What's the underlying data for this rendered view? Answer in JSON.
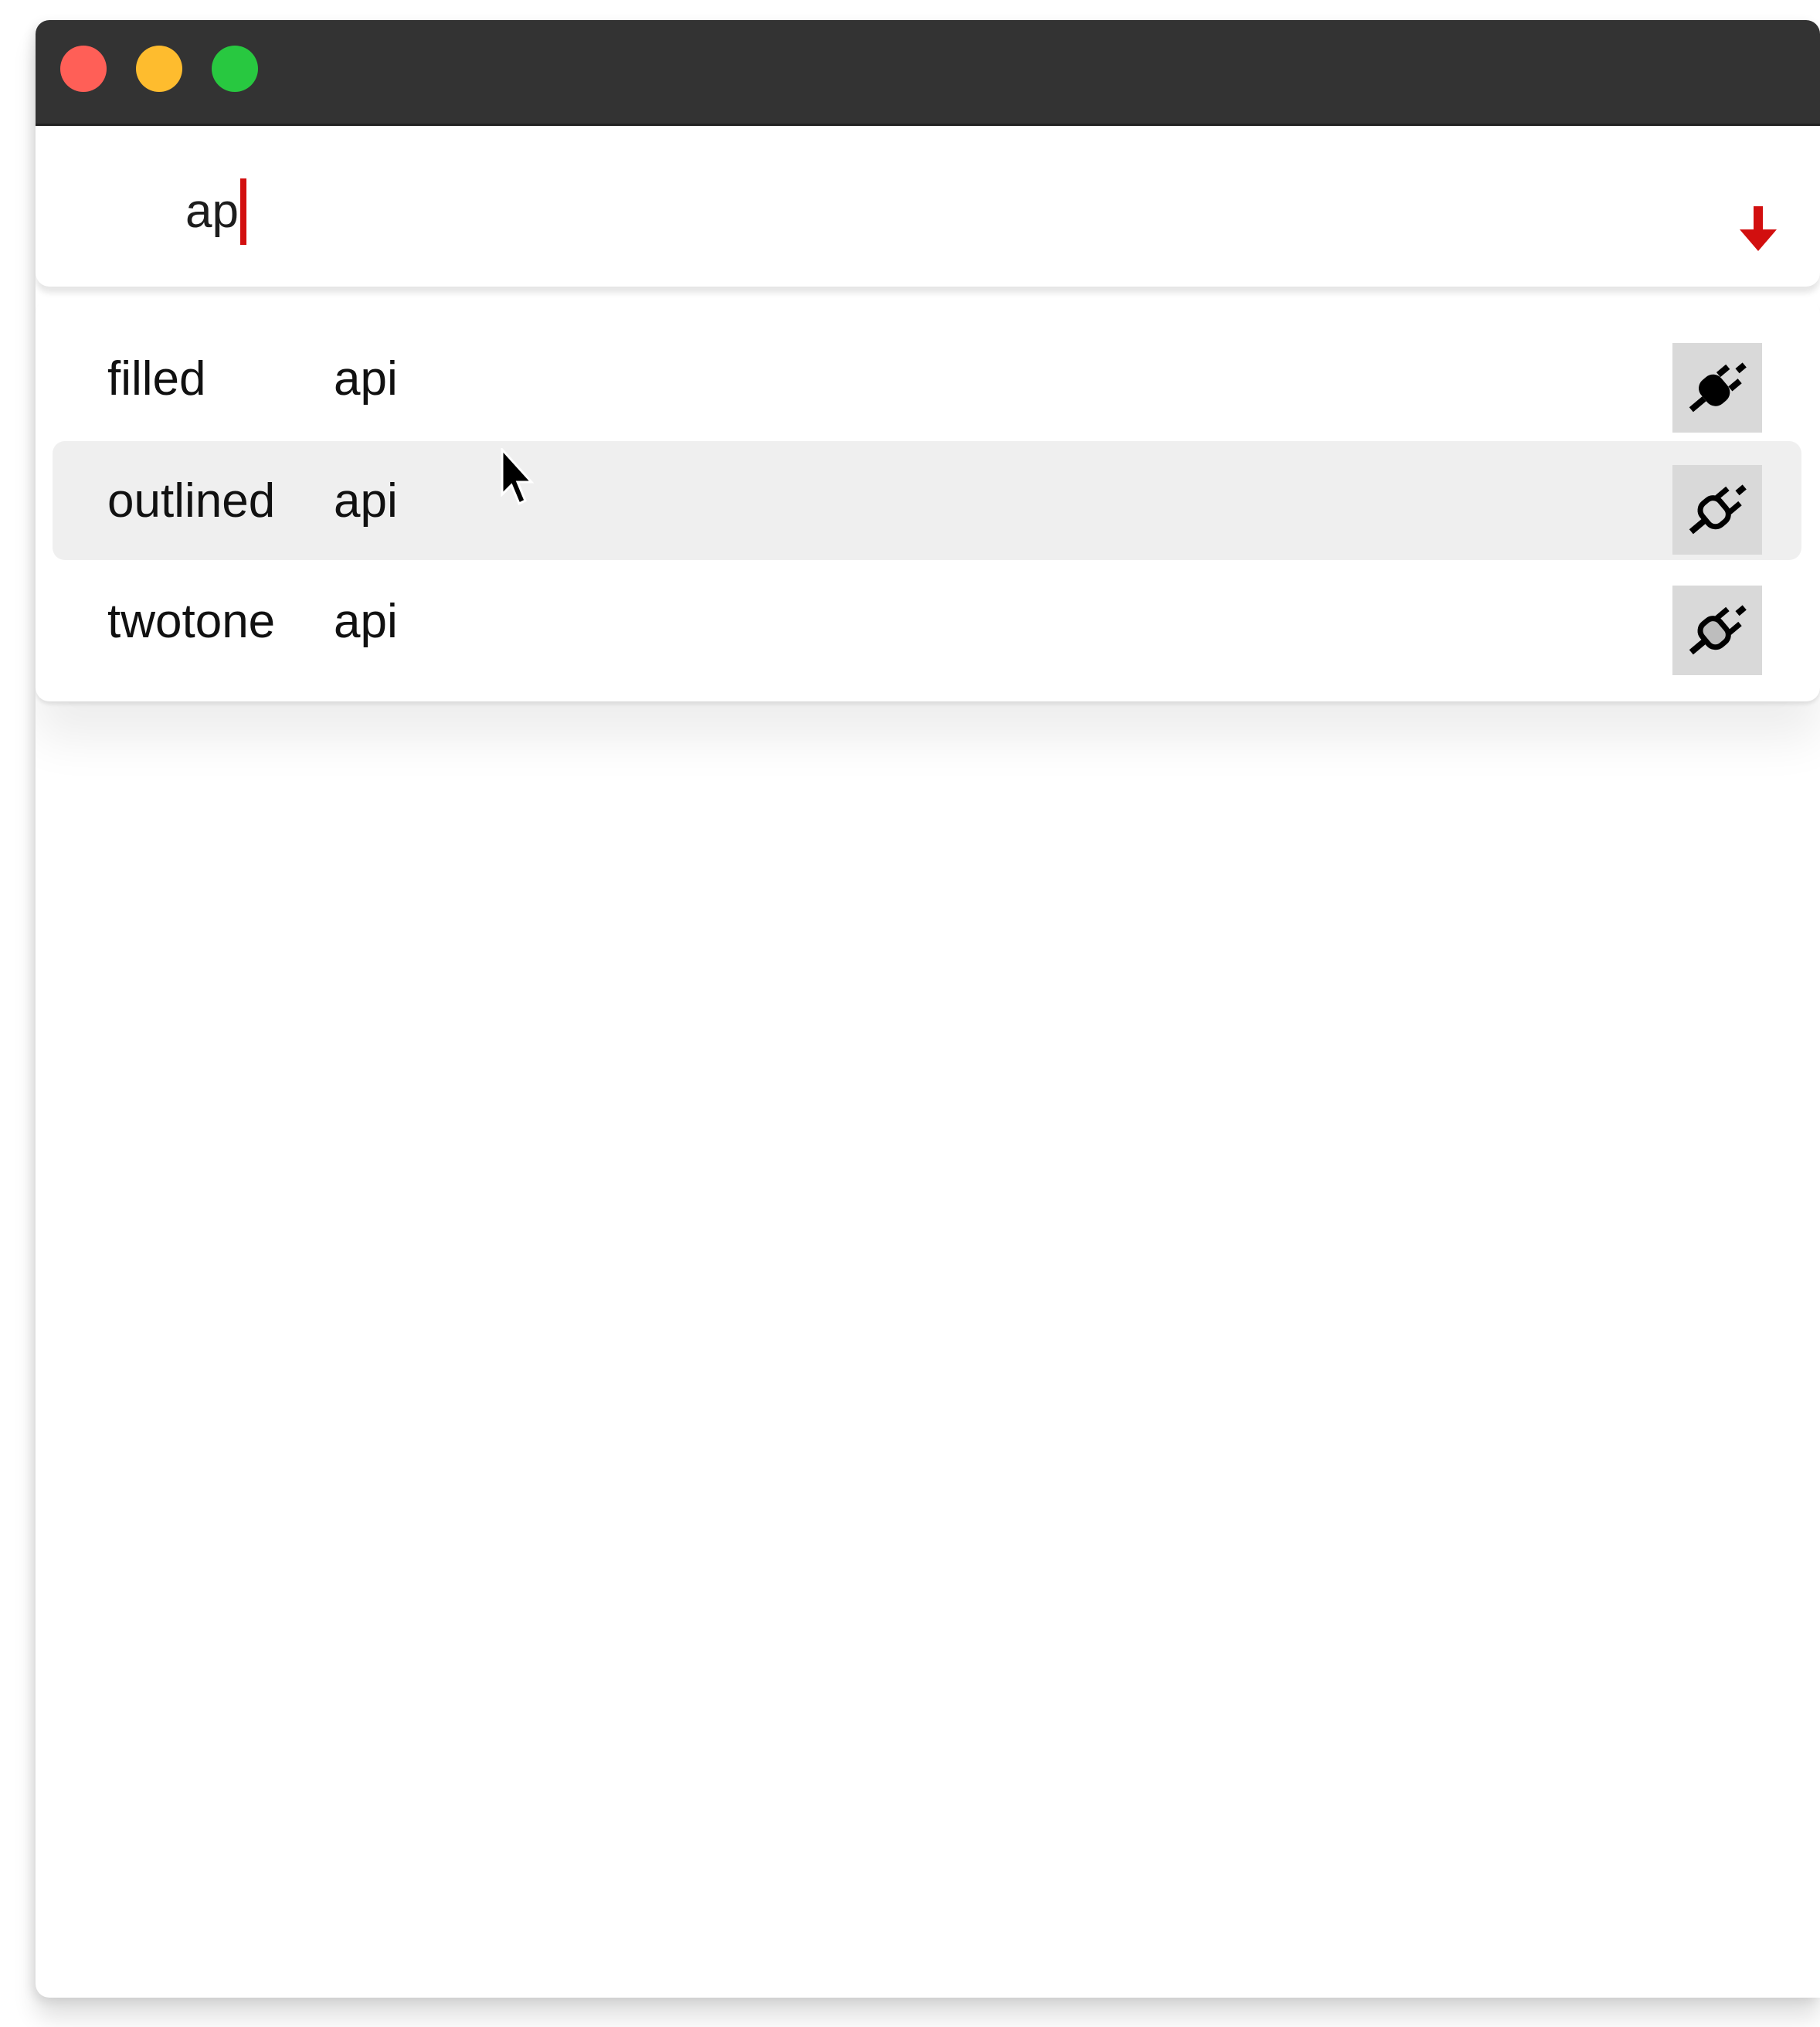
{
  "window": {
    "controls": [
      "close",
      "minimize",
      "zoom"
    ]
  },
  "search": {
    "value": "ap",
    "submit_icon": "arrow-down-icon",
    "accent_color": "#d20f0f"
  },
  "results": [
    {
      "variant": "filled",
      "name": "api",
      "icon": "api-filled-icon"
    },
    {
      "variant": "outlined",
      "name": "api",
      "icon": "api-outlined-icon"
    },
    {
      "variant": "twotone",
      "name": "api",
      "icon": "api-twotone-icon"
    }
  ],
  "hovered_index": 1
}
